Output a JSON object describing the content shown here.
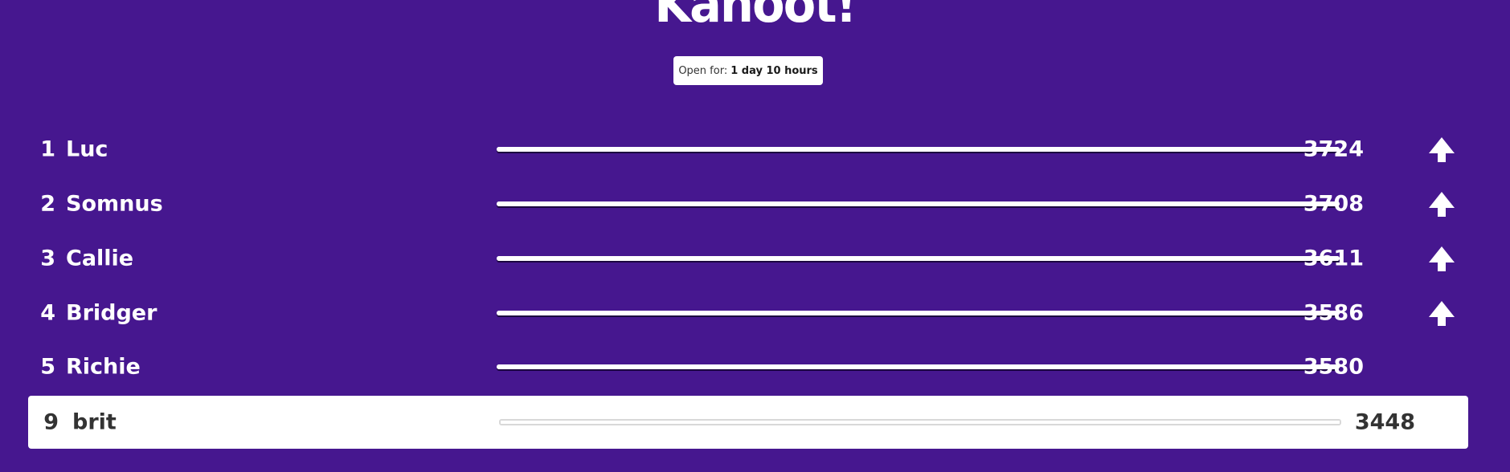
{
  "header": {
    "logo_text": "Kahoot!",
    "open_for_label": "Open for:",
    "open_for_value": "1 day 10 hours"
  },
  "leaderboard": [
    {
      "rank": "1",
      "name": "Luc",
      "score": "3724",
      "progress": 1.0,
      "trend": "up-arrow-icon"
    },
    {
      "rank": "2",
      "name": "Somnus",
      "score": "3708",
      "progress": 1.0,
      "trend": "up-arrow-icon"
    },
    {
      "rank": "3",
      "name": "Callie",
      "score": "3611",
      "progress": 1.0,
      "trend": "up-arrow-icon"
    },
    {
      "rank": "4",
      "name": "Bridger",
      "score": "3586",
      "progress": 1.0,
      "trend": "up-arrow-icon"
    },
    {
      "rank": "5",
      "name": "Richie",
      "score": "3580",
      "progress": 1.0,
      "trend": ""
    }
  ],
  "current_player": {
    "rank": "9",
    "name": "brit",
    "score": "3448",
    "progress": 1.0
  },
  "colors": {
    "background": "#46178f",
    "text_light": "#ffffff",
    "text_dark": "#333333"
  }
}
